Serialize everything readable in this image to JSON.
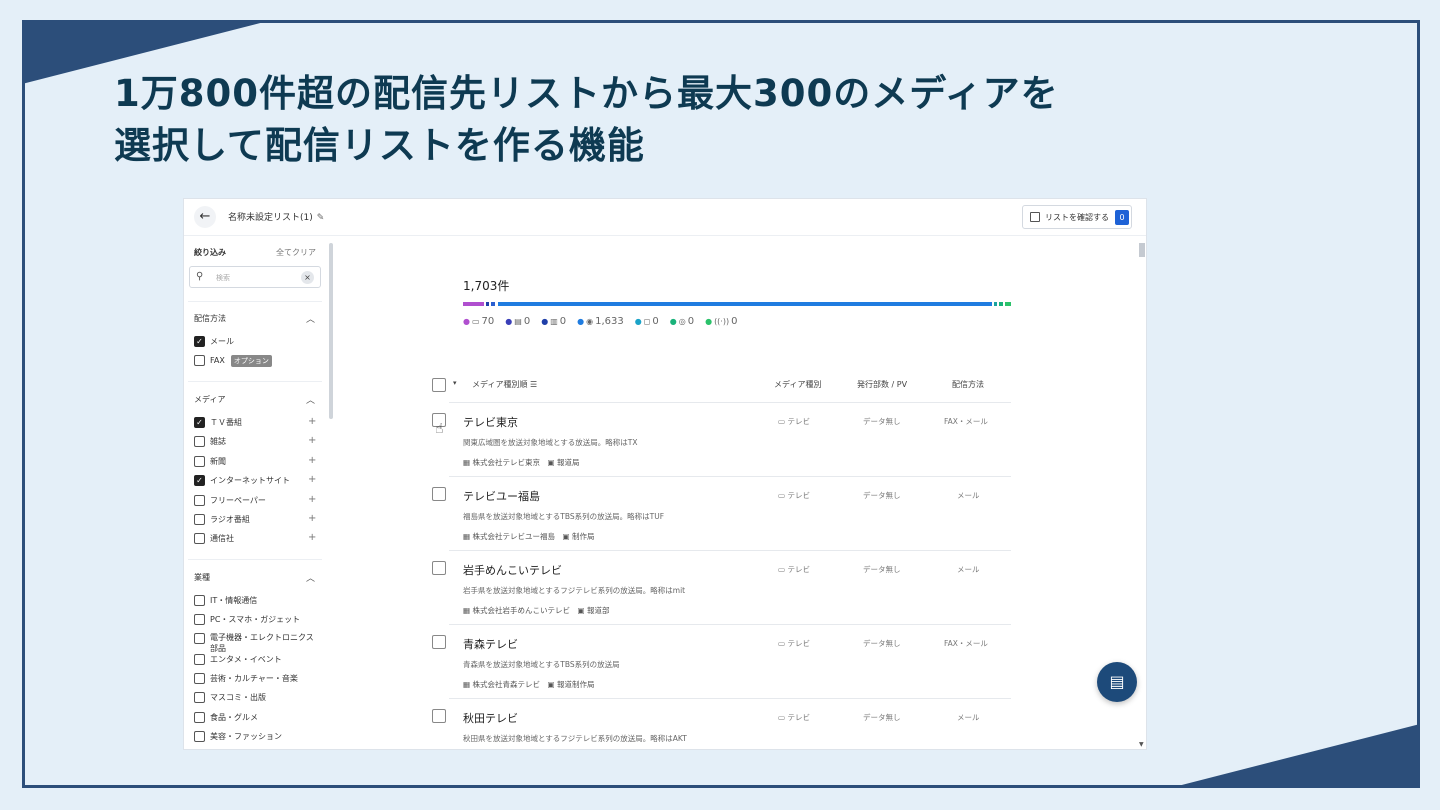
{
  "headline": {
    "line1": "1万800件超の配信先リストから最大300のメディアを",
    "line2": "選択して配信リストを作る機能"
  },
  "app": {
    "list_name": "名称未設定リスト(1)",
    "confirm_button": "リストを確認する",
    "confirm_count": "0"
  },
  "sidebar": {
    "filter_title": "絞り込み",
    "clear_all": "全てクリア",
    "search_placeholder": "検索",
    "delivery_title": "配信方法",
    "delivery_items": [
      {
        "label": "メール",
        "checked": true
      },
      {
        "label": "FAX",
        "checked": false,
        "tag": "オプション"
      }
    ],
    "media_title": "メディア",
    "media_items": [
      {
        "label": "ＴＶ番組",
        "checked": true
      },
      {
        "label": "雑誌",
        "checked": false
      },
      {
        "label": "新聞",
        "checked": false
      },
      {
        "label": "インターネットサイト",
        "checked": true
      },
      {
        "label": "フリーペーパー",
        "checked": false
      },
      {
        "label": "ラジオ番組",
        "checked": false
      },
      {
        "label": "通信社",
        "checked": false
      }
    ],
    "industry_title": "業種",
    "industry_items": [
      {
        "label": "IT・情報通信"
      },
      {
        "label": "PC・スマホ・ガジェット"
      },
      {
        "label": "電子機器・エレクトロニクス部品"
      },
      {
        "label": "エンタメ・イベント"
      },
      {
        "label": "芸術・カルチャー・音楽"
      },
      {
        "label": "マスコミ・出版"
      },
      {
        "label": "食品・グルメ"
      },
      {
        "label": "美容・ファッション"
      }
    ]
  },
  "summary": {
    "count": "1,703件",
    "bar_colors": [
      "#b04fcf",
      "#1f3fa8",
      "#2a5fd0",
      "#1f7ce0",
      "#1aa3a0",
      "#19b27a",
      "#2bc26a"
    ],
    "legend": [
      {
        "icon": "▭",
        "value": "70",
        "color": "#b04fcf"
      },
      {
        "icon": "▤",
        "value": "0",
        "color": "#3a3fb8"
      },
      {
        "icon": "▥",
        "value": "0",
        "color": "#1f3fa8"
      },
      {
        "icon": "◉",
        "value": "1,633",
        "color": "#1f7ce0"
      },
      {
        "icon": "◻",
        "value": "0",
        "color": "#1aa3c8"
      },
      {
        "icon": "◎",
        "value": "0",
        "color": "#19b27a"
      },
      {
        "icon": "((·))",
        "value": "0",
        "color": "#2bc26a"
      }
    ]
  },
  "table": {
    "col_sort": "メディア種別順",
    "col_type": "メディア種別",
    "col_circ": "発行部数 / PV",
    "col_method": "配信方法",
    "rows": [
      {
        "name": "テレビ東京",
        "desc": "関東広域圏を放送対象地域とする放送局。略称はTX",
        "company": "株式会社テレビ東京",
        "dept": "報道局",
        "type": "テレビ",
        "circ": "データ無し",
        "method": "FAX・メール"
      },
      {
        "name": "テレビユー福島",
        "desc": "福島県を放送対象地域とするTBS系列の放送局。略称はTUF",
        "company": "株式会社テレビユー福島",
        "dept": "制作局",
        "type": "テレビ",
        "circ": "データ無し",
        "method": "メール"
      },
      {
        "name": "岩手めんこいテレビ",
        "desc": "岩手県を放送対象地域とするフジテレビ系列の放送局。略称はmit",
        "company": "株式会社岩手めんこいテレビ",
        "dept": "報道部",
        "type": "テレビ",
        "circ": "データ無し",
        "method": "メール"
      },
      {
        "name": "青森テレビ",
        "desc": "青森県を放送対象地域とするTBS系列の放送局",
        "company": "株式会社青森テレビ",
        "dept": "報道制作局",
        "type": "テレビ",
        "circ": "データ無し",
        "method": "FAX・メール"
      },
      {
        "name": "秋田テレビ",
        "desc": "秋田県を放送対象地域とするフジテレビ系列の放送局。略称はAKT",
        "company": "",
        "dept": "",
        "type": "テレビ",
        "circ": "データ無し",
        "method": "メール"
      }
    ]
  }
}
